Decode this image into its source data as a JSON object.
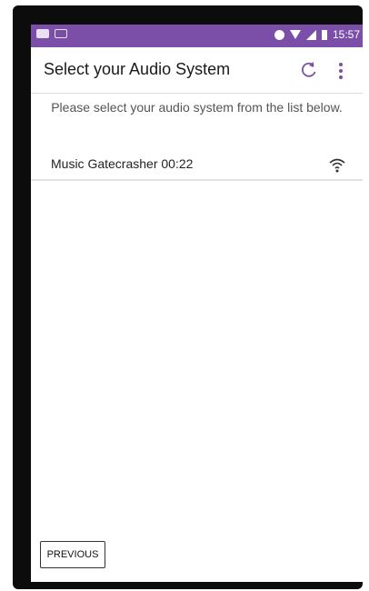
{
  "status_bar": {
    "time": "15:57",
    "icons_left": [
      "notification-icon",
      "mail-icon"
    ],
    "icons_right": [
      "alarm-icon",
      "wifi-icon",
      "signal-icon",
      "battery-icon"
    ]
  },
  "app_bar": {
    "title": "Select your Audio System",
    "actions": [
      "refresh-icon",
      "more-options-icon"
    ]
  },
  "content": {
    "instructions": "Please select your audio system from the list below.",
    "systems": [
      {
        "label": "Music Gatecrasher 00:22",
        "icon": "wifi-icon"
      }
    ]
  },
  "footer": {
    "previous_label": "PREVIOUS"
  },
  "colors": {
    "status_bar": "#7b4fa7",
    "background": "#ffffff",
    "device_frame": "#0c0c0c"
  }
}
